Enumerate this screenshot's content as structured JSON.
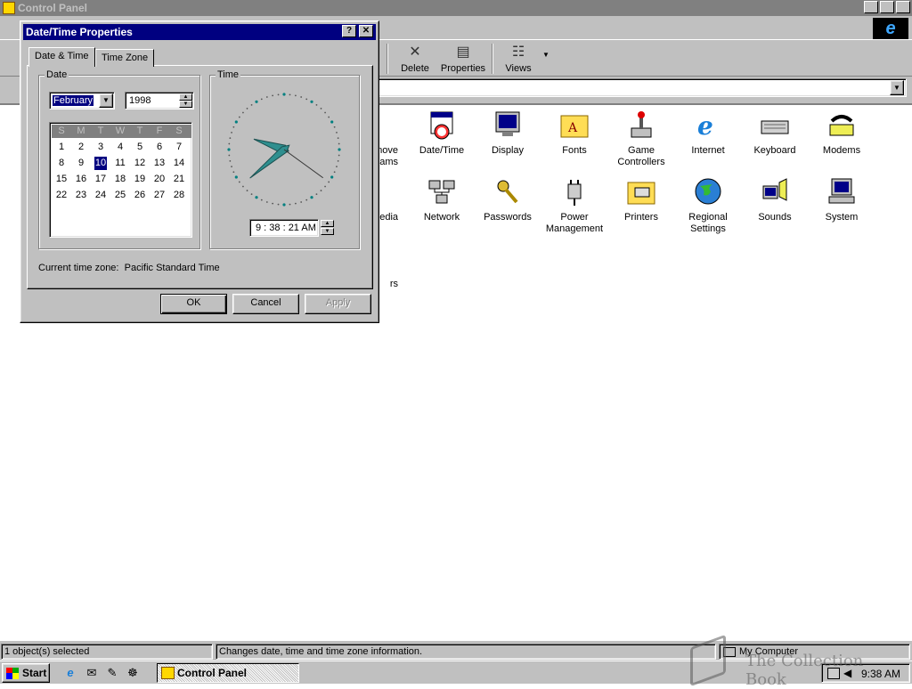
{
  "window": {
    "title": "Control Panel"
  },
  "toolbar": {
    "delete_label": "Delete",
    "properties_label": "Properties",
    "views_label": "Views"
  },
  "icons": [
    {
      "label": "move\nams"
    },
    {
      "label": "Date/Time"
    },
    {
      "label": "Display"
    },
    {
      "label": "Fonts"
    },
    {
      "label": "Game\nControllers"
    },
    {
      "label": "Internet"
    },
    {
      "label": "Keyboard"
    },
    {
      "label": "Modems"
    },
    {
      "label": "edia"
    },
    {
      "label": "Network"
    },
    {
      "label": "Passwords"
    },
    {
      "label": "Power\nManagement"
    },
    {
      "label": "Printers"
    },
    {
      "label": "Regional\nSettings"
    },
    {
      "label": "Sounds"
    },
    {
      "label": "System"
    },
    {
      "label": "rs"
    }
  ],
  "statusbar": {
    "selection": "1 object(s) selected",
    "description": "Changes date, time and time zone information.",
    "location": "My Computer"
  },
  "taskbar": {
    "start_label": "Start",
    "task_label": "Control Panel",
    "clock": "9:38 AM"
  },
  "dialog": {
    "title": "Date/Time Properties",
    "help_glyph": "?",
    "close_glyph": "✕",
    "tabs": [
      "Date & Time",
      "Time Zone"
    ],
    "date_label": "Date",
    "time_label": "Time",
    "month": "February",
    "year": "1998",
    "weekday_headers": [
      "S",
      "M",
      "T",
      "W",
      "T",
      "F",
      "S"
    ],
    "days": [
      "1",
      "2",
      "3",
      "4",
      "5",
      "6",
      "7",
      "8",
      "9",
      "10",
      "11",
      "12",
      "13",
      "14",
      "15",
      "16",
      "17",
      "18",
      "19",
      "20",
      "21",
      "22",
      "23",
      "24",
      "25",
      "26",
      "27",
      "28"
    ],
    "selected_day": "10",
    "time": "9 : 38 : 21 AM",
    "timezone_prefix": "Current time zone:",
    "timezone": "Pacific Standard Time",
    "ok_label": "OK",
    "cancel_label": "Cancel",
    "apply_label": "Apply"
  },
  "clock_face": {
    "hour": 9,
    "minute": 38,
    "second": 21
  },
  "watermark": "The Collection Book",
  "colors": {
    "title_active": "#000080",
    "title_inactive": "#808080",
    "face": "#c0c0c0",
    "clock_hand": "#2f8f8f"
  }
}
